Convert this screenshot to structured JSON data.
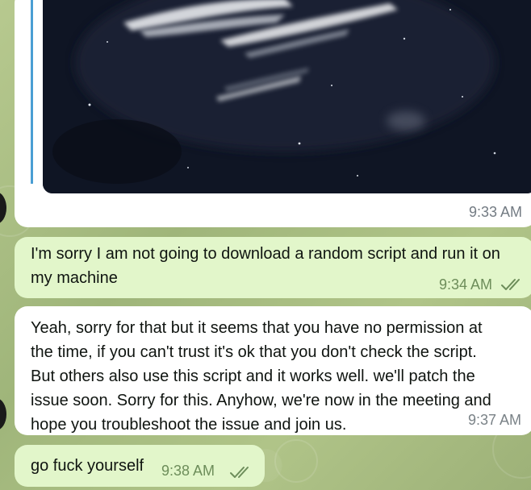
{
  "messages": [
    {
      "kind": "image",
      "direction": "incoming",
      "time": "9:33 AM"
    },
    {
      "kind": "text",
      "direction": "outgoing",
      "lines": [
        "I'm sorry I am not going to download a random script and run it on",
        "my machine"
      ],
      "time": "9:34 AM",
      "status": "read"
    },
    {
      "kind": "text",
      "direction": "incoming",
      "lines": [
        "Yeah, sorry for that but it seems that you have no permission at",
        "the time, if you can't trust it's ok that you don't check the script.",
        "But others also use this script and it works well. we'll patch the",
        "issue soon. Sorry for this. Anyhow, we're now in the meeting and",
        "hope you troubleshoot the issue and join us."
      ],
      "time": "9:37 AM"
    },
    {
      "kind": "text",
      "direction": "outgoing",
      "lines": [
        "go fuck yourself"
      ],
      "time": "9:38 AM",
      "status": "read"
    }
  ],
  "colors": {
    "outgoing_bubble": "#e2f6ca",
    "incoming_bubble": "#ffffff",
    "chat_background": "#a9bd86",
    "read_check": "#6d8d5a",
    "reply_bar": "#4a9ed3"
  },
  "icons": {
    "read_status": "double-check-icon"
  }
}
